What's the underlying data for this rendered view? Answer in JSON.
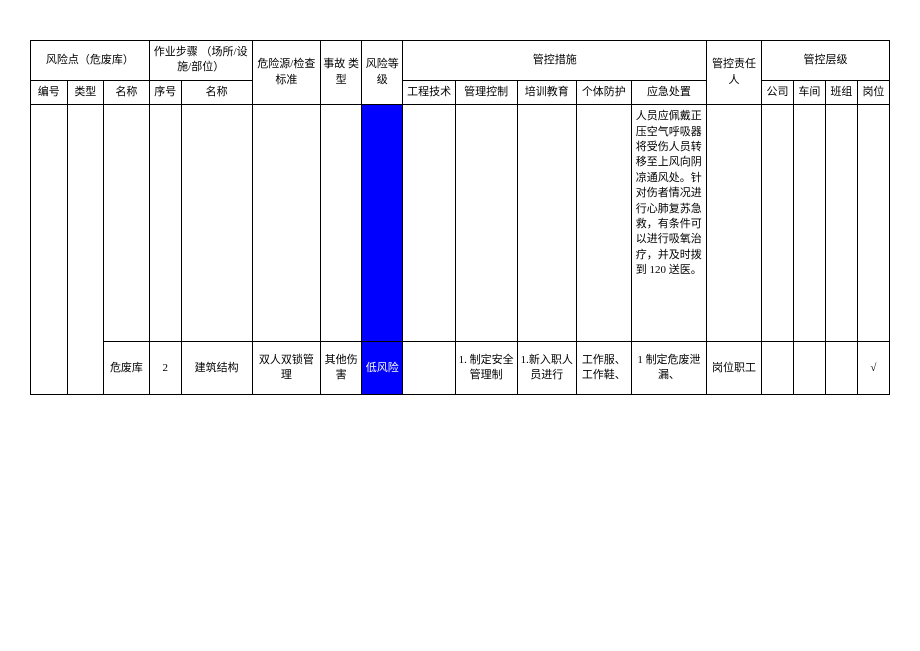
{
  "headers": {
    "risk_point": "风险点（危废库）",
    "work_step": "作业步骤\n（场所/设施/部位）",
    "hazard_std": "危险源/检查\n标准",
    "accident_type": "事故\n类型",
    "risk_level": "风险等\n级",
    "control_measure": "管控措施",
    "responsible": "管控责任人",
    "control_level": "管控层级",
    "id": "编号",
    "type": "类型",
    "name": "名称",
    "seq": "序号",
    "step_name": "名称",
    "eng": "工程技术",
    "mgmt": "管理控制",
    "train": "培训教育",
    "ppe": "个体防护",
    "emerg": "应急处置",
    "company": "公司",
    "workshop": "车间",
    "team": "班组",
    "post": "岗位"
  },
  "row_continuation": {
    "emergency": "人员应佩戴正压空气呼吸器将受伤人员转移至上风向阴凉通风处。针对伤者情况进行心肺复苏急救，有条件可以进行吸氧治疗，并及时拨到 120 送医。"
  },
  "row2": {
    "name": "危废库",
    "seq": "2",
    "step_name": "建筑结构",
    "hazard_std": "双人双锁管理",
    "accident_type": "其他伤害",
    "risk_level": "低风险",
    "mgmt": "1. 制定安全管理制",
    "train": "1.新入职人员进行",
    "ppe": "工作服、工作鞋、",
    "emerg": "1 制定危废泄漏、",
    "responsible": "岗位职工",
    "post_check": "√"
  }
}
